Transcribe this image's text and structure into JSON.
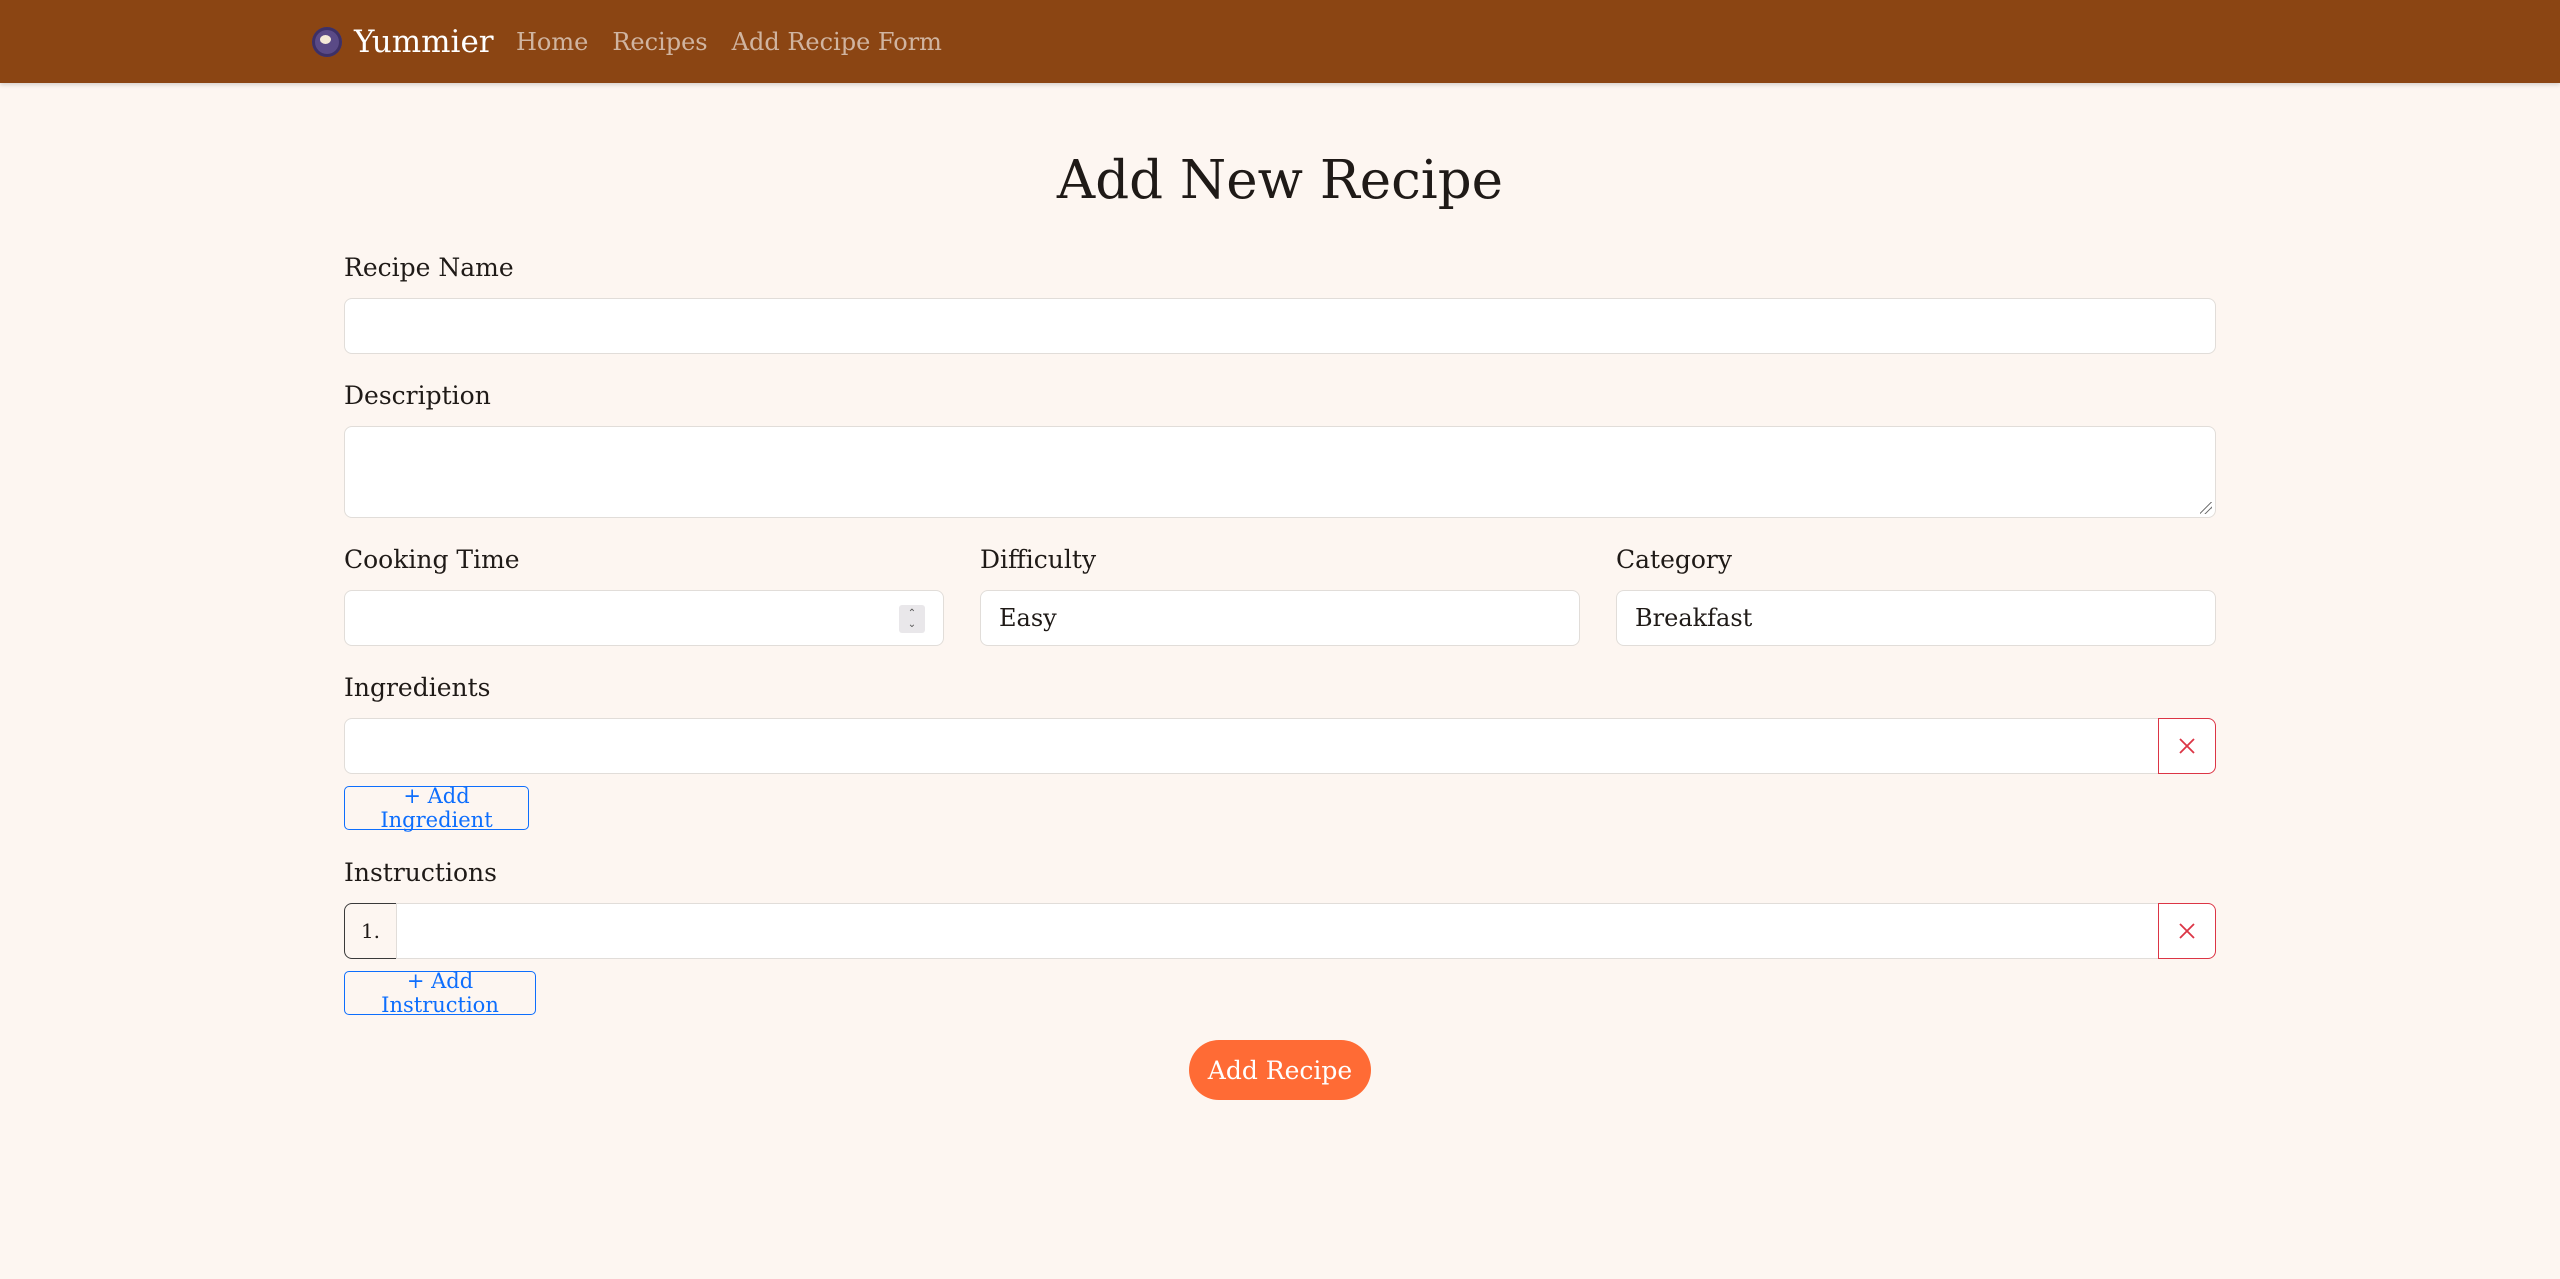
{
  "navbar": {
    "brand": "Yummier",
    "brand_icon": "food-bowl-icon",
    "links": [
      "Home",
      "Recipes",
      "Add Recipe Form"
    ],
    "background": "#8b4513"
  },
  "form": {
    "title": "Add New Recipe",
    "recipe_name": {
      "label": "Recipe Name",
      "value": ""
    },
    "description": {
      "label": "Description",
      "value": ""
    },
    "cooking_time": {
      "label": "Cooking Time",
      "value": ""
    },
    "difficulty": {
      "label": "Difficulty",
      "value": "Easy"
    },
    "category": {
      "label": "Category",
      "value": "Breakfast"
    },
    "ingredients": {
      "label": "Ingredients",
      "items": [
        ""
      ],
      "add_label": "+ Add Ingredient"
    },
    "instructions": {
      "label": "Instructions",
      "items": [
        {
          "number": "1.",
          "text": ""
        }
      ],
      "add_label": "+ Add Instruction"
    },
    "submit_label": "Add Recipe"
  },
  "colors": {
    "page_background": "#fdf6f1",
    "accent": "#ff6b35",
    "link_blue": "#0d6efd",
    "danger": "#dc3545"
  }
}
